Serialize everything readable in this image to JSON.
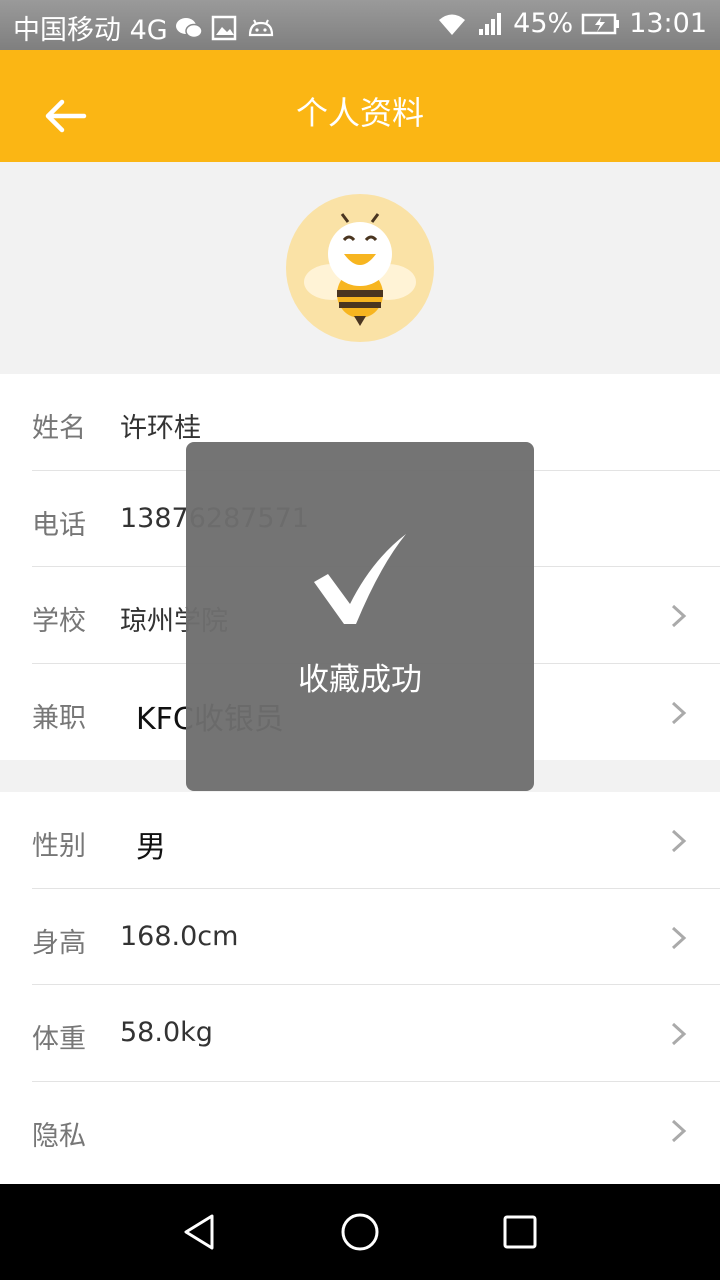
{
  "status_bar": {
    "carrier": "中国移动 4G",
    "battery": "45%",
    "time": "13:01",
    "icons": [
      "wechat-icon",
      "image-icon",
      "android-icon",
      "wifi-icon",
      "signal-icon",
      "battery-icon"
    ]
  },
  "header": {
    "title": "个人资料",
    "back_icon": "back-arrow-icon",
    "color": "#fbb614"
  },
  "avatar": {
    "icon": "bee-avatar-icon"
  },
  "basic_info": [
    {
      "label": "姓名",
      "value": "许环桂",
      "chevron": false
    },
    {
      "label": "电话",
      "value": "13876287571",
      "chevron": false
    },
    {
      "label": "学校",
      "value": "琼州学院",
      "chevron": true
    },
    {
      "label": "兼职",
      "value": "KFC收银员",
      "chevron": true
    }
  ],
  "body_info": [
    {
      "label": "性别",
      "value": "男",
      "chevron": true
    },
    {
      "label": "身高",
      "value": "168.0cm",
      "chevron": true
    },
    {
      "label": "体重",
      "value": "58.0kg",
      "chevron": true
    },
    {
      "label": "隐私",
      "value": "",
      "chevron": true
    }
  ],
  "toast": {
    "icon": "checkmark-icon",
    "message": "收藏成功"
  },
  "nav_bar": {
    "icons": [
      "nav-back-icon",
      "nav-home-icon",
      "nav-recents-icon"
    ]
  }
}
